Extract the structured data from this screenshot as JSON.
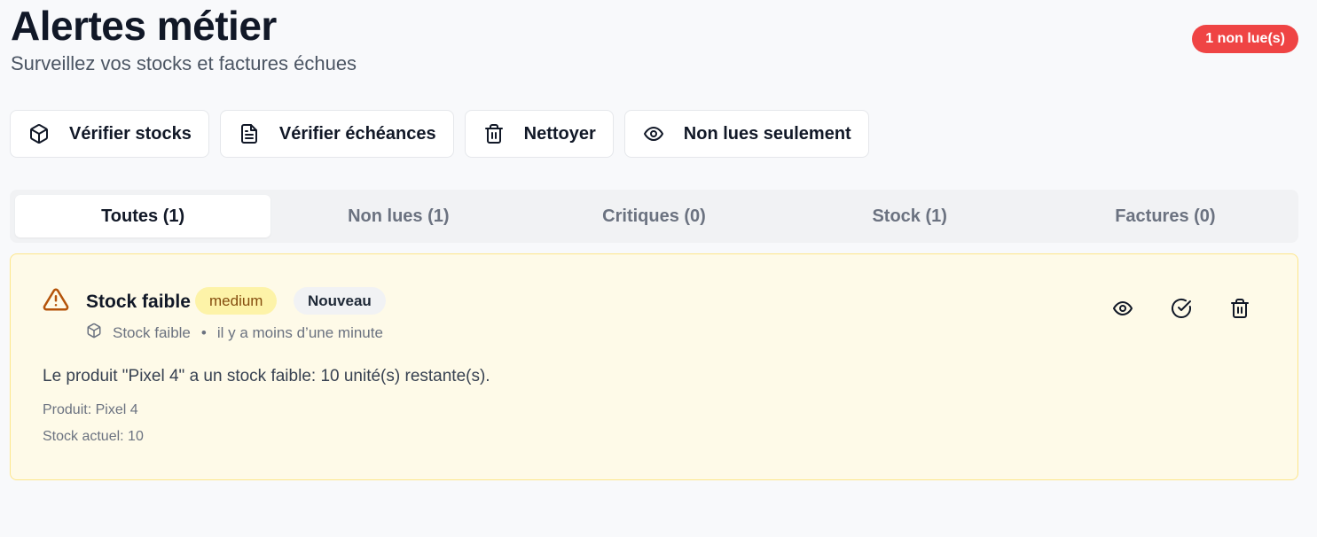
{
  "header": {
    "title": "Alertes métier",
    "subtitle": "Surveillez vos stocks et factures échues",
    "unread_badge": "1 non lue(s)"
  },
  "actions": [
    {
      "label": "Vérifier stocks",
      "icon": "package-icon"
    },
    {
      "label": "Vérifier échéances",
      "icon": "file-text-icon"
    },
    {
      "label": "Nettoyer",
      "icon": "trash-icon"
    },
    {
      "label": "Non lues seulement",
      "icon": "eye-icon"
    }
  ],
  "tabs": [
    {
      "label": "Toutes (1)",
      "active": true
    },
    {
      "label": "Non lues (1)",
      "active": false
    },
    {
      "label": "Critiques (0)",
      "active": false
    },
    {
      "label": "Stock (1)",
      "active": false
    },
    {
      "label": "Factures (0)",
      "active": false
    }
  ],
  "alert": {
    "title": "Stock faible",
    "severity": "medium",
    "status": "Nouveau",
    "type": "Stock faible",
    "time": "il y a moins d’une minute",
    "separator": "•",
    "message": "Le produit \"Pixel 4\" a un stock faible: 10 unité(s) restante(s).",
    "product": "Produit: Pixel 4",
    "stock": "Stock actuel: 10",
    "icons": {
      "warning": "warning-triangle-icon",
      "type": "package-icon",
      "view": "eye-icon",
      "mark_read": "check-circle-icon",
      "delete": "trash-icon"
    }
  },
  "colors": {
    "unread_badge": "#ef4444",
    "card_bg": "#fefae8",
    "card_border": "#fde68a",
    "warning": "#b45309",
    "severity_bg": "#fdf3a8",
    "severity_text": "#854d0e"
  }
}
